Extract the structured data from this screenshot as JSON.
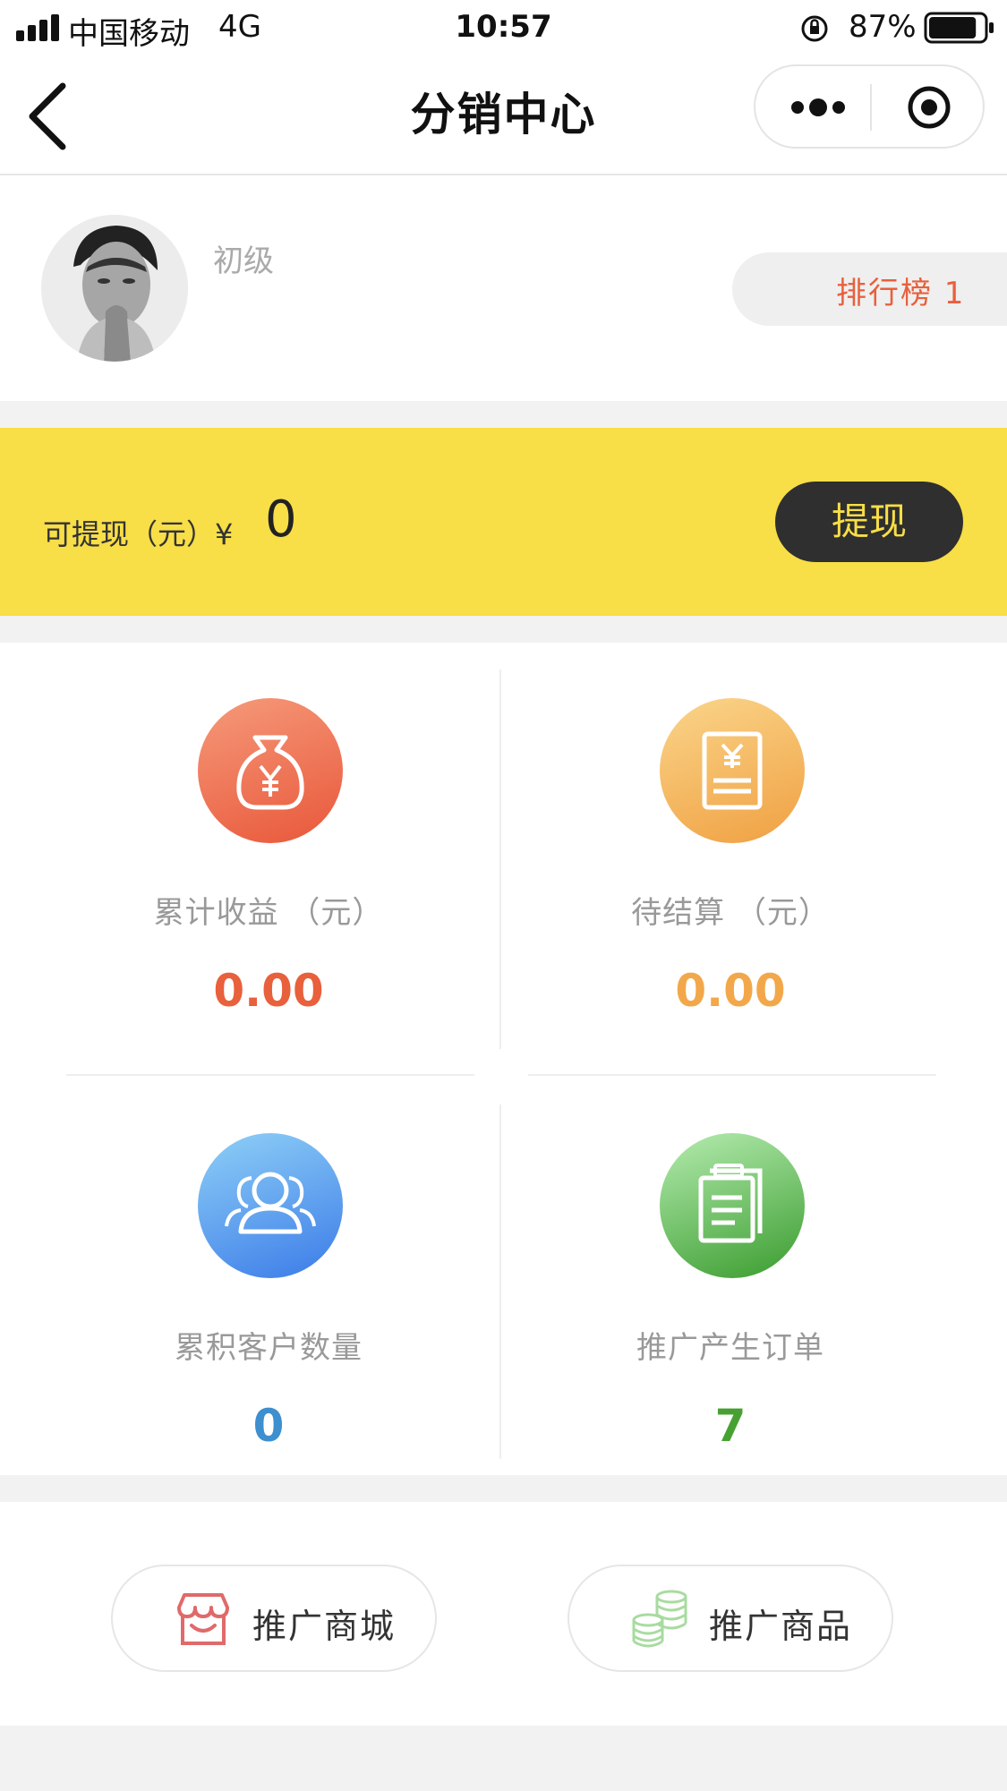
{
  "status_bar": {
    "carrier": "中国移动",
    "network": "4G",
    "time": "10:57",
    "battery": "87%",
    "battery_level": 0.87
  },
  "nav": {
    "title": "分销中心",
    "back_icon": "chevron-left-icon",
    "more_icon": "more-dots-icon",
    "close_icon": "target-circle-icon"
  },
  "profile": {
    "level": "初级",
    "rank_label": "排行榜 1"
  },
  "withdraw": {
    "label": "可提现（元）¥",
    "amount": "0",
    "button": "提现",
    "accent": "#f8de47",
    "button_bg": "#2f2f2f"
  },
  "stats": [
    {
      "label": "累计收益 （元）",
      "value": "0.00",
      "icon": "money-bag-icon",
      "color": "#e8603c"
    },
    {
      "label": "待结算 （元）",
      "value": "0.00",
      "icon": "receipt-icon",
      "color": "#f2a84a"
    },
    {
      "label": "累积客户数量",
      "value": "0",
      "icon": "users-icon",
      "color": "#3d8fcf"
    },
    {
      "label": "推广产生订单",
      "value": "7",
      "icon": "clipboard-icon",
      "color": "#47a132"
    }
  ],
  "promo": {
    "mall": {
      "label": "推广商城",
      "icon": "store-icon"
    },
    "products": {
      "label": "推广商品",
      "icon": "coins-icon"
    }
  }
}
